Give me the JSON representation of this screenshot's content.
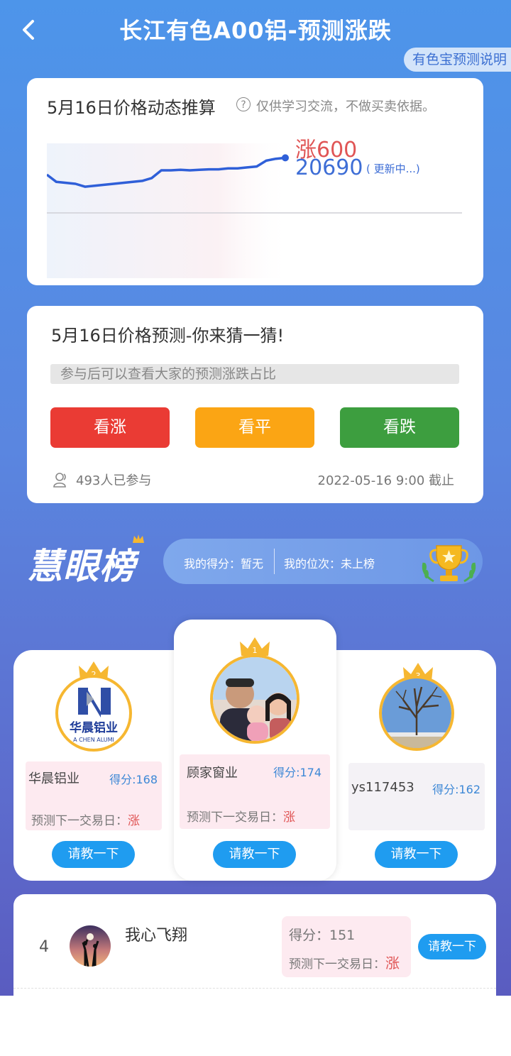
{
  "header": {
    "title": "长江有色A00铝-预测涨跌",
    "help_label": "有色宝预测说明"
  },
  "price_card": {
    "title": "5月16日价格动态推算",
    "note": "仅供学习交流，不做买卖依据。",
    "change": "涨600",
    "price": "20690",
    "status": "( 更新中...)"
  },
  "chart_data": {
    "type": "line",
    "series": [
      {
        "values": [
          20655,
          20640,
          20638,
          20636,
          20630,
          20632,
          20634,
          20636,
          20638,
          20640,
          20642,
          20648,
          20664,
          20664,
          20665,
          20664,
          20665,
          20666,
          20666,
          20668,
          20668,
          20670,
          20672,
          20684,
          20688,
          20690
        ]
      }
    ],
    "ylim": [
      20440,
      20720
    ],
    "color": "#2f5fd8",
    "grid": false
  },
  "vote_card": {
    "title": "5月16日价格预测-你来猜一猜!",
    "hint": "参与后可以查看大家的预测涨跌占比",
    "up_label": "看涨",
    "flat_label": "看平",
    "down_label": "看跌",
    "participants": "493人已参与",
    "deadline": "2022-05-16    9:00 截止",
    "colors": {
      "up": "#ea3b34",
      "flat": "#fba514",
      "down": "#3d9e3f"
    }
  },
  "leaderboard": {
    "logo_text": "慧眼榜",
    "my_score": "我的得分：暂无",
    "my_rank": "我的位次：未上榜",
    "top3": [
      {
        "rank": "1",
        "name": "顾家窗业",
        "score": "得分:174",
        "pred_label": "预测下一交易日：",
        "pred": "涨",
        "ask": "请教一下"
      },
      {
        "rank": "2",
        "name": "华晨铝业",
        "score": "得分:168",
        "pred_label": "预测下一交易日：",
        "pred": "涨",
        "ask": "请教一下",
        "logo_text": "华晨铝业",
        "logo_sub": "A CHEN ALUMI"
      },
      {
        "rank": "3",
        "name": "ys117453",
        "score": "得分:162",
        "ask": "请教一下"
      }
    ],
    "others": [
      {
        "rank": "4",
        "name": "我心飞翔",
        "score": "得分：151",
        "pred_label": "预测下一交易日：",
        "pred": "涨",
        "ask": "请教一下"
      }
    ]
  }
}
